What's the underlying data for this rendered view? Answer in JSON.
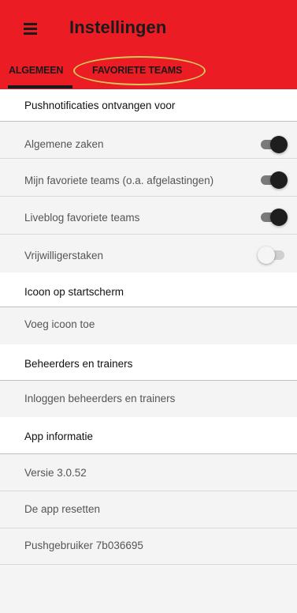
{
  "appbar": {
    "title": "Instellingen",
    "menu_icon": "hamburger-menu-icon",
    "background": "#ec1c24"
  },
  "tabs": [
    {
      "label": "Algemeen",
      "selected": true
    },
    {
      "label": "Favoriete teams",
      "selected": false
    }
  ],
  "sections": {
    "push": {
      "header": "Pushnotificaties ontvangen voor",
      "items": [
        {
          "label": "Algemene zaken",
          "enabled": true
        },
        {
          "label": "Mijn favoriete teams (o.a. afgelastingen)",
          "enabled": true
        },
        {
          "label": "Liveblog favoriete teams",
          "enabled": true
        },
        {
          "label": "Vrijwilligerstaken",
          "enabled": false
        }
      ]
    },
    "icon": {
      "header": "Icoon op startscherm",
      "items": [
        {
          "label": "Voeg icoon toe"
        }
      ]
    },
    "admins": {
      "header": "Beheerders en trainers",
      "items": [
        {
          "label": "Inloggen beheerders en trainers"
        }
      ]
    },
    "info": {
      "header": "App informatie",
      "items": [
        {
          "label": "Versie 3.0.52"
        },
        {
          "label": "De app resetten"
        },
        {
          "label": "Pushgebruiker 7b036695"
        }
      ]
    }
  }
}
